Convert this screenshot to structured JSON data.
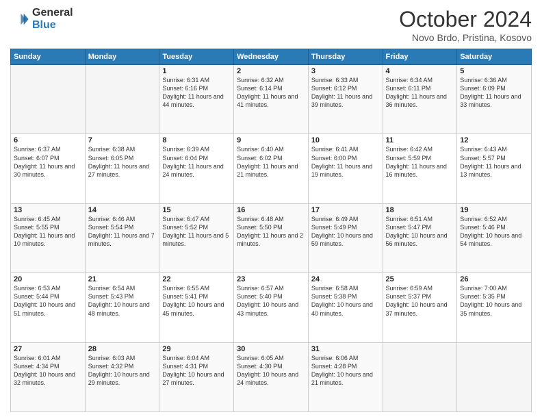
{
  "header": {
    "logo_general": "General",
    "logo_blue": "Blue",
    "month_title": "October 2024",
    "location": "Novo Brdo, Pristina, Kosovo"
  },
  "weekdays": [
    "Sunday",
    "Monday",
    "Tuesday",
    "Wednesday",
    "Thursday",
    "Friday",
    "Saturday"
  ],
  "weeks": [
    [
      {
        "day": "",
        "info": ""
      },
      {
        "day": "",
        "info": ""
      },
      {
        "day": "1",
        "info": "Sunrise: 6:31 AM\nSunset: 6:16 PM\nDaylight: 11 hours and 44 minutes."
      },
      {
        "day": "2",
        "info": "Sunrise: 6:32 AM\nSunset: 6:14 PM\nDaylight: 11 hours and 41 minutes."
      },
      {
        "day": "3",
        "info": "Sunrise: 6:33 AM\nSunset: 6:12 PM\nDaylight: 11 hours and 39 minutes."
      },
      {
        "day": "4",
        "info": "Sunrise: 6:34 AM\nSunset: 6:11 PM\nDaylight: 11 hours and 36 minutes."
      },
      {
        "day": "5",
        "info": "Sunrise: 6:36 AM\nSunset: 6:09 PM\nDaylight: 11 hours and 33 minutes."
      }
    ],
    [
      {
        "day": "6",
        "info": "Sunrise: 6:37 AM\nSunset: 6:07 PM\nDaylight: 11 hours and 30 minutes."
      },
      {
        "day": "7",
        "info": "Sunrise: 6:38 AM\nSunset: 6:05 PM\nDaylight: 11 hours and 27 minutes."
      },
      {
        "day": "8",
        "info": "Sunrise: 6:39 AM\nSunset: 6:04 PM\nDaylight: 11 hours and 24 minutes."
      },
      {
        "day": "9",
        "info": "Sunrise: 6:40 AM\nSunset: 6:02 PM\nDaylight: 11 hours and 21 minutes."
      },
      {
        "day": "10",
        "info": "Sunrise: 6:41 AM\nSunset: 6:00 PM\nDaylight: 11 hours and 19 minutes."
      },
      {
        "day": "11",
        "info": "Sunrise: 6:42 AM\nSunset: 5:59 PM\nDaylight: 11 hours and 16 minutes."
      },
      {
        "day": "12",
        "info": "Sunrise: 6:43 AM\nSunset: 5:57 PM\nDaylight: 11 hours and 13 minutes."
      }
    ],
    [
      {
        "day": "13",
        "info": "Sunrise: 6:45 AM\nSunset: 5:55 PM\nDaylight: 11 hours and 10 minutes."
      },
      {
        "day": "14",
        "info": "Sunrise: 6:46 AM\nSunset: 5:54 PM\nDaylight: 11 hours and 7 minutes."
      },
      {
        "day": "15",
        "info": "Sunrise: 6:47 AM\nSunset: 5:52 PM\nDaylight: 11 hours and 5 minutes."
      },
      {
        "day": "16",
        "info": "Sunrise: 6:48 AM\nSunset: 5:50 PM\nDaylight: 11 hours and 2 minutes."
      },
      {
        "day": "17",
        "info": "Sunrise: 6:49 AM\nSunset: 5:49 PM\nDaylight: 10 hours and 59 minutes."
      },
      {
        "day": "18",
        "info": "Sunrise: 6:51 AM\nSunset: 5:47 PM\nDaylight: 10 hours and 56 minutes."
      },
      {
        "day": "19",
        "info": "Sunrise: 6:52 AM\nSunset: 5:46 PM\nDaylight: 10 hours and 54 minutes."
      }
    ],
    [
      {
        "day": "20",
        "info": "Sunrise: 6:53 AM\nSunset: 5:44 PM\nDaylight: 10 hours and 51 minutes."
      },
      {
        "day": "21",
        "info": "Sunrise: 6:54 AM\nSunset: 5:43 PM\nDaylight: 10 hours and 48 minutes."
      },
      {
        "day": "22",
        "info": "Sunrise: 6:55 AM\nSunset: 5:41 PM\nDaylight: 10 hours and 45 minutes."
      },
      {
        "day": "23",
        "info": "Sunrise: 6:57 AM\nSunset: 5:40 PM\nDaylight: 10 hours and 43 minutes."
      },
      {
        "day": "24",
        "info": "Sunrise: 6:58 AM\nSunset: 5:38 PM\nDaylight: 10 hours and 40 minutes."
      },
      {
        "day": "25",
        "info": "Sunrise: 6:59 AM\nSunset: 5:37 PM\nDaylight: 10 hours and 37 minutes."
      },
      {
        "day": "26",
        "info": "Sunrise: 7:00 AM\nSunset: 5:35 PM\nDaylight: 10 hours and 35 minutes."
      }
    ],
    [
      {
        "day": "27",
        "info": "Sunrise: 6:01 AM\nSunset: 4:34 PM\nDaylight: 10 hours and 32 minutes."
      },
      {
        "day": "28",
        "info": "Sunrise: 6:03 AM\nSunset: 4:32 PM\nDaylight: 10 hours and 29 minutes."
      },
      {
        "day": "29",
        "info": "Sunrise: 6:04 AM\nSunset: 4:31 PM\nDaylight: 10 hours and 27 minutes."
      },
      {
        "day": "30",
        "info": "Sunrise: 6:05 AM\nSunset: 4:30 PM\nDaylight: 10 hours and 24 minutes."
      },
      {
        "day": "31",
        "info": "Sunrise: 6:06 AM\nSunset: 4:28 PM\nDaylight: 10 hours and 21 minutes."
      },
      {
        "day": "",
        "info": ""
      },
      {
        "day": "",
        "info": ""
      }
    ]
  ]
}
